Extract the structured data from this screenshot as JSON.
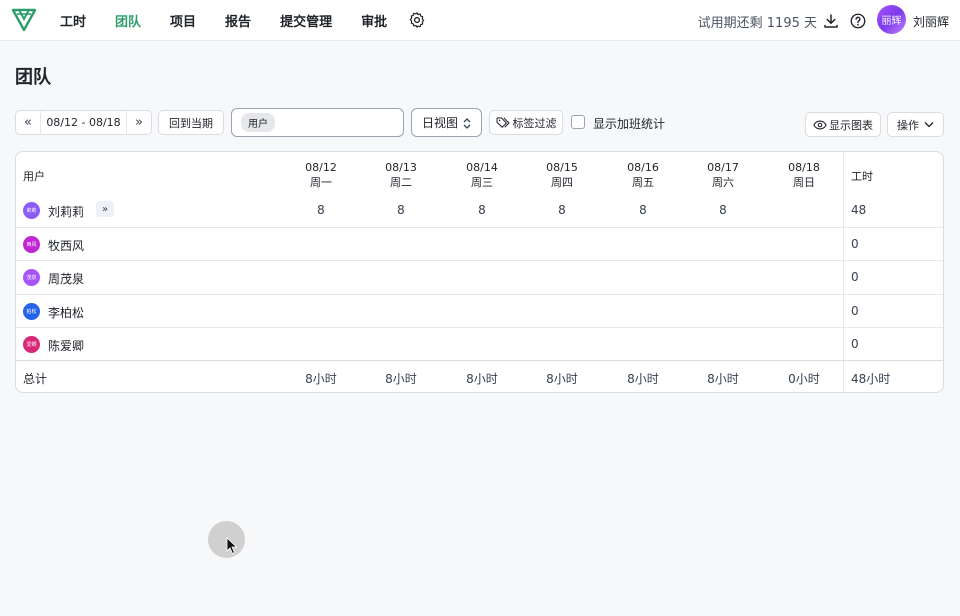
{
  "nav": {
    "items": [
      {
        "label": "工时",
        "active": false
      },
      {
        "label": "团队",
        "active": true
      },
      {
        "label": "项目",
        "active": false
      },
      {
        "label": "报告",
        "active": false
      },
      {
        "label": "提交管理",
        "active": false
      },
      {
        "label": "审批",
        "active": false
      }
    ],
    "trial_text": "试用期还剩 1195 天",
    "user": {
      "avatar_text": "丽辉",
      "name": "刘丽辉"
    }
  },
  "page": {
    "title": "团队"
  },
  "toolbar": {
    "date_range": "08/12 - 08/18",
    "current_period_label": "回到当期",
    "user_chip": "用户",
    "view_select": "日视图",
    "tag_filter_label": "标签过滤",
    "overtime_label": "显示加班统计",
    "show_chart_label": "显示图表",
    "actions_label": "操作"
  },
  "table": {
    "user_header": "用户",
    "hours_header": "工时",
    "days": [
      {
        "date": "08/12",
        "weekday": "周一"
      },
      {
        "date": "08/13",
        "weekday": "周二"
      },
      {
        "date": "08/14",
        "weekday": "周三"
      },
      {
        "date": "08/15",
        "weekday": "周四"
      },
      {
        "date": "08/16",
        "weekday": "周五"
      },
      {
        "date": "08/17",
        "weekday": "周六"
      },
      {
        "date": "08/18",
        "weekday": "周日"
      }
    ],
    "rows": [
      {
        "avatar": "莉莉",
        "name": "刘莉莉",
        "color": "#8b5cf6",
        "hours": [
          "8",
          "8",
          "8",
          "8",
          "8",
          "8",
          ""
        ],
        "total": "48",
        "expand": "»"
      },
      {
        "avatar": "西风",
        "name": "牧西风",
        "color": "#c026d3",
        "hours": [
          "",
          "",
          "",
          "",
          "",
          "",
          ""
        ],
        "total": "0"
      },
      {
        "avatar": "茂泉",
        "name": "周茂泉",
        "color": "#a855f7",
        "hours": [
          "",
          "",
          "",
          "",
          "",
          "",
          ""
        ],
        "total": "0"
      },
      {
        "avatar": "柏松",
        "name": "李柏松",
        "color": "#2563eb",
        "hours": [
          "",
          "",
          "",
          "",
          "",
          "",
          ""
        ],
        "total": "0"
      },
      {
        "avatar": "爱卿",
        "name": "陈爱卿",
        "color": "#db2777",
        "hours": [
          "",
          "",
          "",
          "",
          "",
          "",
          ""
        ],
        "total": "0"
      }
    ],
    "footer": {
      "label": "总计",
      "day_totals": [
        "8小时",
        "8小时",
        "8小时",
        "8小时",
        "8小时",
        "8小时",
        "0小时"
      ],
      "grand_total": "48小时"
    }
  }
}
